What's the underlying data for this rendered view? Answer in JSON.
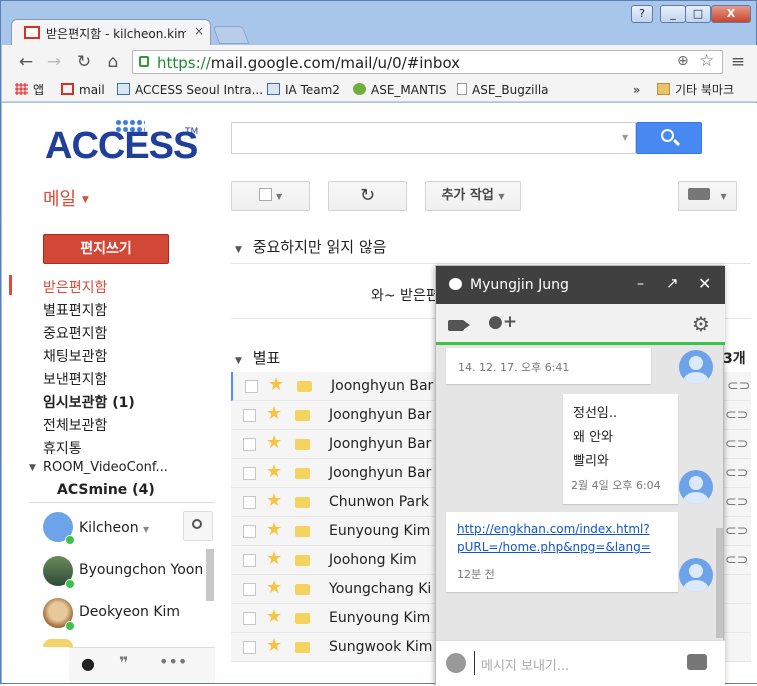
{
  "browser": {
    "tab_title": "받은편지함 - kilcheon.kim",
    "url_https": "https://",
    "url_rest": "mail.google.com/mail/u/0/#inbox",
    "window_buttons": {
      "help": "?",
      "minimize": "_",
      "maximize": "□",
      "close": "X"
    }
  },
  "bookmarks": {
    "items": [
      {
        "label": "앱",
        "icon": "apps-grid-icon"
      },
      {
        "label": "mail",
        "icon": "gmail-icon"
      },
      {
        "label": "ACCESS Seoul Intra...",
        "icon": "page-icon"
      },
      {
        "label": "IA Team2",
        "icon": "page-icon"
      },
      {
        "label": "ASE_MANTIS",
        "icon": "mantis-icon"
      },
      {
        "label": "ASE_Bugzilla",
        "icon": "document-icon"
      }
    ],
    "overflow": "»",
    "other_bookmarks": "기타 북마크"
  },
  "gmail": {
    "logo": "ACCESS",
    "logo_tm": "TM",
    "mail_label": "메일",
    "compose": "편지쓰기",
    "more_actions": "추가 작업",
    "nav": [
      {
        "label": "받은편지함",
        "state": "active"
      },
      {
        "label": "별표편지함"
      },
      {
        "label": "중요편지함"
      },
      {
        "label": "채팅보관함"
      },
      {
        "label": "보낸편지함"
      },
      {
        "label": "임시보관함 (1)",
        "state": "bold"
      },
      {
        "label": "전체보관함"
      },
      {
        "label": "휴지통"
      }
    ],
    "room": "ROOM_VideoConf...",
    "acsmine": "ACSmine (4)",
    "me": "Kilcheon",
    "contacts": [
      "Byoungchon Yoon",
      "Deokyeon Kim"
    ],
    "section_important": "중요하지만 읽지 않음",
    "empty_text": "와~ 받은편",
    "section_starred": "별표",
    "count_text": "3개",
    "rows": [
      {
        "sender": "Joonghyun Bar"
      },
      {
        "sender": "Joonghyun Bar"
      },
      {
        "sender": "Joonghyun Bar"
      },
      {
        "sender": "Joonghyun Bar"
      },
      {
        "sender": "Chunwon Park"
      },
      {
        "sender": "Eunyoung Kim"
      },
      {
        "sender": "Joohong Kim"
      },
      {
        "sender": "Youngchang Ki"
      },
      {
        "sender": "Eunyoung Kim"
      },
      {
        "sender": "Sungwook Kim"
      }
    ]
  },
  "chat": {
    "name": "Myungjin Jung",
    "messages": [
      {
        "time": "14. 12. 17. 오후 6:41"
      },
      {
        "lines": [
          "정선임..",
          "왜 안와",
          "빨리와"
        ],
        "time": "2월 4일 오후 6:04"
      },
      {
        "link": "http://engkhan.com/index.html?pURL=/home.php&npg=&lang=",
        "link_line1": "http://engkhan.com/index.html?",
        "link_line2": "pURL=/home.php&npg=&lang=",
        "time": "12분 전"
      }
    ],
    "input_placeholder": "메시지 보내기..."
  },
  "colors": {
    "accent_red": "#dd4b39",
    "search_blue": "#4889f1",
    "online_green": "#3ac349",
    "chat_head": "#404040"
  }
}
